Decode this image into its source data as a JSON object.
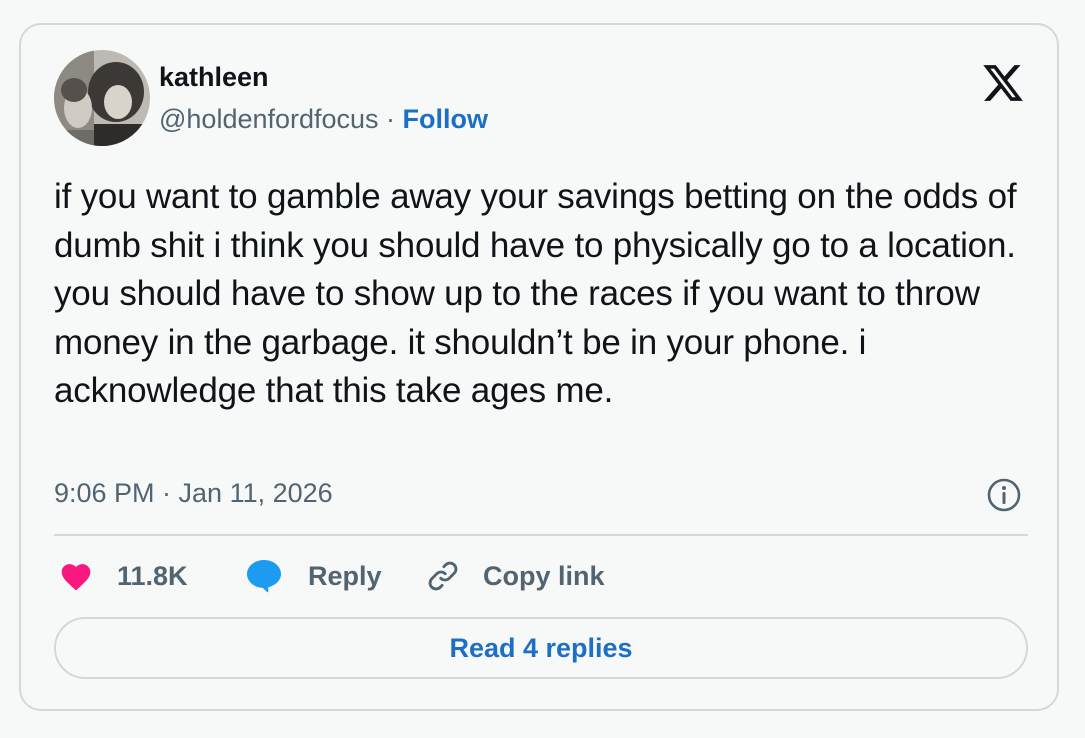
{
  "tweet": {
    "author": {
      "display_name": "kathleen",
      "handle": "@holdenfordfocus",
      "separator": " · ",
      "follow_label": "Follow",
      "avatar": "black-and-white-portrait-avatar"
    },
    "platform_icon": "x-logo-icon",
    "text": "if you want to gamble away your savings betting on the odds of dumb shit i think you should have to physically go to a location. you should have to show up to the races if you want to throw money in the garbage. it shouldn’t be in your phone. i acknowledge that this take ages me.",
    "timestamp": "9:06 PM · Jan 11, 2026",
    "info_icon": "info-icon",
    "actions": {
      "like": {
        "icon": "heart-icon",
        "label": "11.8K",
        "color": "#f91880"
      },
      "reply": {
        "icon": "speech-bubble-icon",
        "label": "Reply",
        "color": "#1d9bf0"
      },
      "copy_link": {
        "icon": "link-icon",
        "label": "Copy link"
      }
    },
    "read_replies_label": "Read 4 replies"
  },
  "colors": {
    "link_blue": "#1d6fc4",
    "text_primary": "#0f1419",
    "text_secondary": "#536471",
    "border": "#cfd9de",
    "background": "#f7f9f9"
  }
}
